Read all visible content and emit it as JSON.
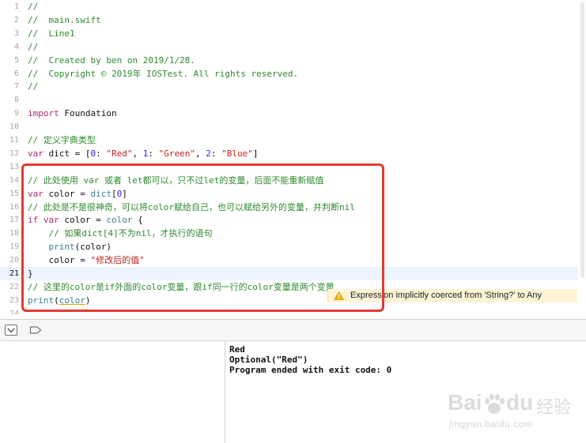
{
  "editor": {
    "lines": [
      {
        "n": "1",
        "tokens": [
          {
            "t": "//",
            "k": "com"
          }
        ]
      },
      {
        "n": "2",
        "tokens": [
          {
            "t": "//  main.swift",
            "k": "com"
          }
        ]
      },
      {
        "n": "3",
        "tokens": [
          {
            "t": "//  Line1",
            "k": "com"
          }
        ]
      },
      {
        "n": "4",
        "tokens": [
          {
            "t": "//",
            "k": "com"
          }
        ]
      },
      {
        "n": "5",
        "tokens": [
          {
            "t": "//  Created by ben on 2019/1/28.",
            "k": "com"
          }
        ]
      },
      {
        "n": "6",
        "tokens": [
          {
            "t": "//  Copyright © 2019年 IOSTest. All rights reserved.",
            "k": "com"
          }
        ]
      },
      {
        "n": "7",
        "tokens": [
          {
            "t": "//",
            "k": "com"
          }
        ]
      },
      {
        "n": "8",
        "tokens": []
      },
      {
        "n": "9",
        "tokens": [
          {
            "t": "import",
            "k": "kw"
          },
          {
            "t": " Foundation",
            "k": "pln"
          }
        ]
      },
      {
        "n": "10",
        "tokens": []
      },
      {
        "n": "11",
        "tokens": [
          {
            "t": "// 定义字典类型",
            "k": "com"
          }
        ]
      },
      {
        "n": "12",
        "tokens": [
          {
            "t": "var",
            "k": "kw"
          },
          {
            "t": " dict = [",
            "k": "pln"
          },
          {
            "t": "0",
            "k": "num"
          },
          {
            "t": ": ",
            "k": "pln"
          },
          {
            "t": "\"Red\"",
            "k": "str"
          },
          {
            "t": ", ",
            "k": "pln"
          },
          {
            "t": "1",
            "k": "num"
          },
          {
            "t": ": ",
            "k": "pln"
          },
          {
            "t": "\"Green\"",
            "k": "str"
          },
          {
            "t": ", ",
            "k": "pln"
          },
          {
            "t": "2",
            "k": "num"
          },
          {
            "t": ": ",
            "k": "pln"
          },
          {
            "t": "\"Blue\"",
            "k": "str"
          },
          {
            "t": "]",
            "k": "pln"
          }
        ]
      },
      {
        "n": "13",
        "tokens": []
      },
      {
        "n": "14",
        "tokens": [
          {
            "t": "// 此处使用 var 或者 let都可以，只不过let的变量，后面不能重新赋值",
            "k": "com"
          }
        ]
      },
      {
        "n": "15",
        "tokens": [
          {
            "t": "var",
            "k": "kw"
          },
          {
            "t": " color = ",
            "k": "pln"
          },
          {
            "t": "dict",
            "k": "typ"
          },
          {
            "t": "[",
            "k": "pln"
          },
          {
            "t": "0",
            "k": "num"
          },
          {
            "t": "]",
            "k": "pln"
          }
        ]
      },
      {
        "n": "16",
        "tokens": [
          {
            "t": "// 此处是不是很神奇，可以将color赋给自己，也可以赋给另外的变量，并判断nil",
            "k": "com"
          }
        ]
      },
      {
        "n": "17",
        "tokens": [
          {
            "t": "if",
            "k": "kw"
          },
          {
            "t": " ",
            "k": "pln"
          },
          {
            "t": "var",
            "k": "kw"
          },
          {
            "t": " color = ",
            "k": "pln"
          },
          {
            "t": "color",
            "k": "typ"
          },
          {
            "t": " {",
            "k": "pln"
          }
        ]
      },
      {
        "n": "18",
        "tokens": [
          {
            "t": "    // 如果dict[4]不为nil，才执行的语句",
            "k": "com"
          }
        ]
      },
      {
        "n": "19",
        "tokens": [
          {
            "t": "    ",
            "k": "pln"
          },
          {
            "t": "print",
            "k": "typ"
          },
          {
            "t": "(color)",
            "k": "pln"
          }
        ]
      },
      {
        "n": "20",
        "tokens": [
          {
            "t": "    color = ",
            "k": "pln"
          },
          {
            "t": "\"修改后的值\"",
            "k": "str"
          }
        ]
      },
      {
        "n": "21",
        "tokens": [
          {
            "t": "}",
            "k": "pln"
          }
        ],
        "current": true
      },
      {
        "n": "22",
        "tokens": [
          {
            "t": "// 这里的color是if外面的color变量，跟if同一行的color变量是两个变量",
            "k": "com"
          }
        ]
      },
      {
        "n": "23",
        "tokens": [
          {
            "t": "print",
            "k": "typ"
          },
          {
            "t": "(",
            "k": "pln"
          },
          {
            "t": "color",
            "k": "typ"
          },
          {
            "t": ")",
            "k": "pln"
          }
        ]
      },
      {
        "n": "24",
        "tokens": []
      }
    ],
    "warning": {
      "text": "Expression implicitly coerced from 'String?' to Any",
      "icon": "warning-triangle-icon",
      "color": "#fdf3d5"
    },
    "highlight_color": "#e23b33",
    "current_line_color": "#ecf5ff"
  },
  "debug_bar": {
    "buttons": [
      {
        "name": "hide-debug-area-button",
        "icon": "hide-debug-area-icon"
      },
      {
        "name": "breakpoint-toggle-button",
        "icon": "breakpoint-icon"
      }
    ]
  },
  "console": {
    "lines": [
      "Red",
      "Optional(\"Red\")",
      "Program ended with exit code: 0"
    ]
  },
  "watermark": {
    "brand": "Baidu",
    "brand_cn": "经验",
    "url": "jingyan.baidu.com"
  }
}
